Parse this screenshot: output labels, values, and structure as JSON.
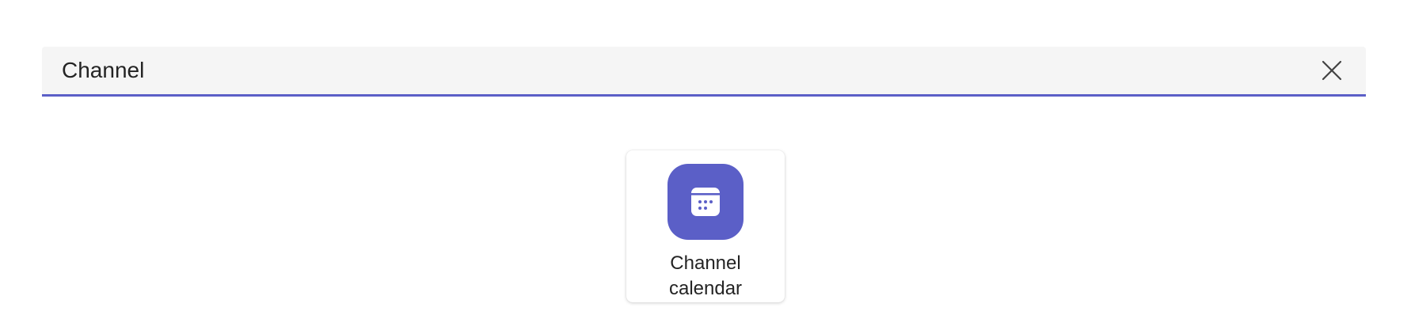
{
  "search": {
    "value": "Channel",
    "clear_icon": "close-icon"
  },
  "results": [
    {
      "name": "Channel calendar",
      "icon": "calendar-icon",
      "icon_color": "#5b5fc7"
    }
  ],
  "colors": {
    "accent": "#5b5fc7",
    "search_bg": "#f5f5f5",
    "text": "#242424"
  }
}
